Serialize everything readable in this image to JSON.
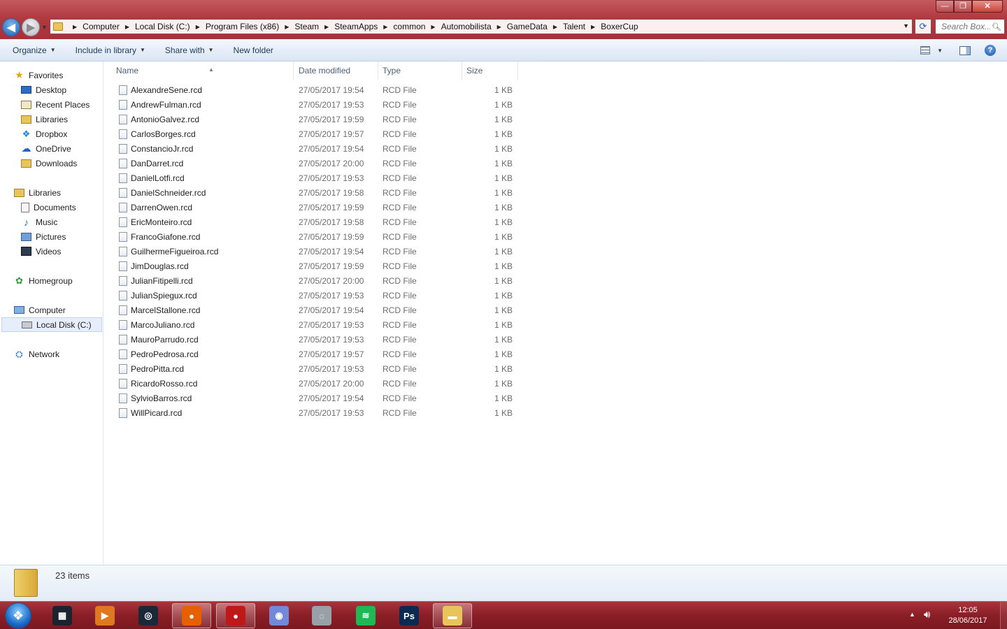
{
  "window": {
    "controls": {
      "minimize": "—",
      "maximize": "❐",
      "close": "✕"
    }
  },
  "addressbar": {
    "crumbs": [
      "Computer",
      "Local Disk (C:)",
      "Program Files (x86)",
      "Steam",
      "SteamApps",
      "common",
      "Automobilista",
      "GameData",
      "Talent",
      "BoxerCup"
    ]
  },
  "search": {
    "placeholder": "Search Box..."
  },
  "toolbar": {
    "organize": "Organize",
    "include_in_library": "Include in library",
    "share_with": "Share with",
    "new_folder": "New folder"
  },
  "sidebar": {
    "favorites": {
      "label": "Favorites",
      "items": [
        "Desktop",
        "Recent Places",
        "Libraries",
        "Dropbox",
        "OneDrive",
        "Downloads"
      ]
    },
    "libraries": {
      "label": "Libraries",
      "items": [
        "Documents",
        "Music",
        "Pictures",
        "Videos"
      ]
    },
    "homegroup": {
      "label": "Homegroup"
    },
    "computer": {
      "label": "Computer",
      "items": [
        "Local Disk (C:)"
      ]
    },
    "network": {
      "label": "Network"
    }
  },
  "columns": {
    "name": "Name",
    "date": "Date modified",
    "type": "Type",
    "size": "Size"
  },
  "files": [
    {
      "name": "AlexandreSene.rcd",
      "date": "27/05/2017 19:54",
      "type": "RCD File",
      "size": "1 KB"
    },
    {
      "name": "AndrewFulman.rcd",
      "date": "27/05/2017 19:53",
      "type": "RCD File",
      "size": "1 KB"
    },
    {
      "name": "AntonioGalvez.rcd",
      "date": "27/05/2017 19:59",
      "type": "RCD File",
      "size": "1 KB"
    },
    {
      "name": "CarlosBorges.rcd",
      "date": "27/05/2017 19:57",
      "type": "RCD File",
      "size": "1 KB"
    },
    {
      "name": "ConstancioJr.rcd",
      "date": "27/05/2017 19:54",
      "type": "RCD File",
      "size": "1 KB"
    },
    {
      "name": "DanDarret.rcd",
      "date": "27/05/2017 20:00",
      "type": "RCD File",
      "size": "1 KB"
    },
    {
      "name": "DanielLotfi.rcd",
      "date": "27/05/2017 19:53",
      "type": "RCD File",
      "size": "1 KB"
    },
    {
      "name": "DanielSchneider.rcd",
      "date": "27/05/2017 19:58",
      "type": "RCD File",
      "size": "1 KB"
    },
    {
      "name": "DarrenOwen.rcd",
      "date": "27/05/2017 19:59",
      "type": "RCD File",
      "size": "1 KB"
    },
    {
      "name": "EricMonteiro.rcd",
      "date": "27/05/2017 19:58",
      "type": "RCD File",
      "size": "1 KB"
    },
    {
      "name": "FrancoGiafone.rcd",
      "date": "27/05/2017 19:59",
      "type": "RCD File",
      "size": "1 KB"
    },
    {
      "name": "GuilhermeFigueiroa.rcd",
      "date": "27/05/2017 19:54",
      "type": "RCD File",
      "size": "1 KB"
    },
    {
      "name": "JimDouglas.rcd",
      "date": "27/05/2017 19:59",
      "type": "RCD File",
      "size": "1 KB"
    },
    {
      "name": "JulianFitipelli.rcd",
      "date": "27/05/2017 20:00",
      "type": "RCD File",
      "size": "1 KB"
    },
    {
      "name": "JulianSpiegux.rcd",
      "date": "27/05/2017 19:53",
      "type": "RCD File",
      "size": "1 KB"
    },
    {
      "name": "MarcelStallone.rcd",
      "date": "27/05/2017 19:54",
      "type": "RCD File",
      "size": "1 KB"
    },
    {
      "name": "MarcoJuliano.rcd",
      "date": "27/05/2017 19:53",
      "type": "RCD File",
      "size": "1 KB"
    },
    {
      "name": "MauroParrudo.rcd",
      "date": "27/05/2017 19:53",
      "type": "RCD File",
      "size": "1 KB"
    },
    {
      "name": "PedroPedrosa.rcd",
      "date": "27/05/2017 19:57",
      "type": "RCD File",
      "size": "1 KB"
    },
    {
      "name": "PedroPitta.rcd",
      "date": "27/05/2017 19:53",
      "type": "RCD File",
      "size": "1 KB"
    },
    {
      "name": "RicardoRosso.rcd",
      "date": "27/05/2017 20:00",
      "type": "RCD File",
      "size": "1 KB"
    },
    {
      "name": "SylvioBarros.rcd",
      "date": "27/05/2017 19:54",
      "type": "RCD File",
      "size": "1 KB"
    },
    {
      "name": "WillPicard.rcd",
      "date": "27/05/2017 19:53",
      "type": "RCD File",
      "size": "1 KB"
    }
  ],
  "details": {
    "item_count": "23 items"
  },
  "taskbar": {
    "apps": [
      {
        "name": "media-player-icon",
        "glyph": "▦",
        "color": "#1a2430",
        "active": false
      },
      {
        "name": "media-center-icon",
        "glyph": "▶",
        "color": "#e07820",
        "active": false
      },
      {
        "name": "steam-icon",
        "glyph": "◎",
        "color": "#1b2838",
        "active": false
      },
      {
        "name": "firefox-icon",
        "glyph": "●",
        "color": "#e66000",
        "active": true
      },
      {
        "name": "record-icon",
        "glyph": "●",
        "color": "#c01818",
        "active": true
      },
      {
        "name": "discord-icon",
        "glyph": "◉",
        "color": "#7289da",
        "active": false
      },
      {
        "name": "disc-icon",
        "glyph": "◌",
        "color": "#9aa0a8",
        "active": false
      },
      {
        "name": "spotify-icon",
        "glyph": "≋",
        "color": "#1db954",
        "active": false
      },
      {
        "name": "photoshop-icon",
        "glyph": "Ps",
        "color": "#0a2a50",
        "active": false
      },
      {
        "name": "explorer-icon",
        "glyph": "▬",
        "color": "#e8c45a",
        "active": true
      }
    ],
    "time": "12:05",
    "date": "28/06/2017"
  }
}
